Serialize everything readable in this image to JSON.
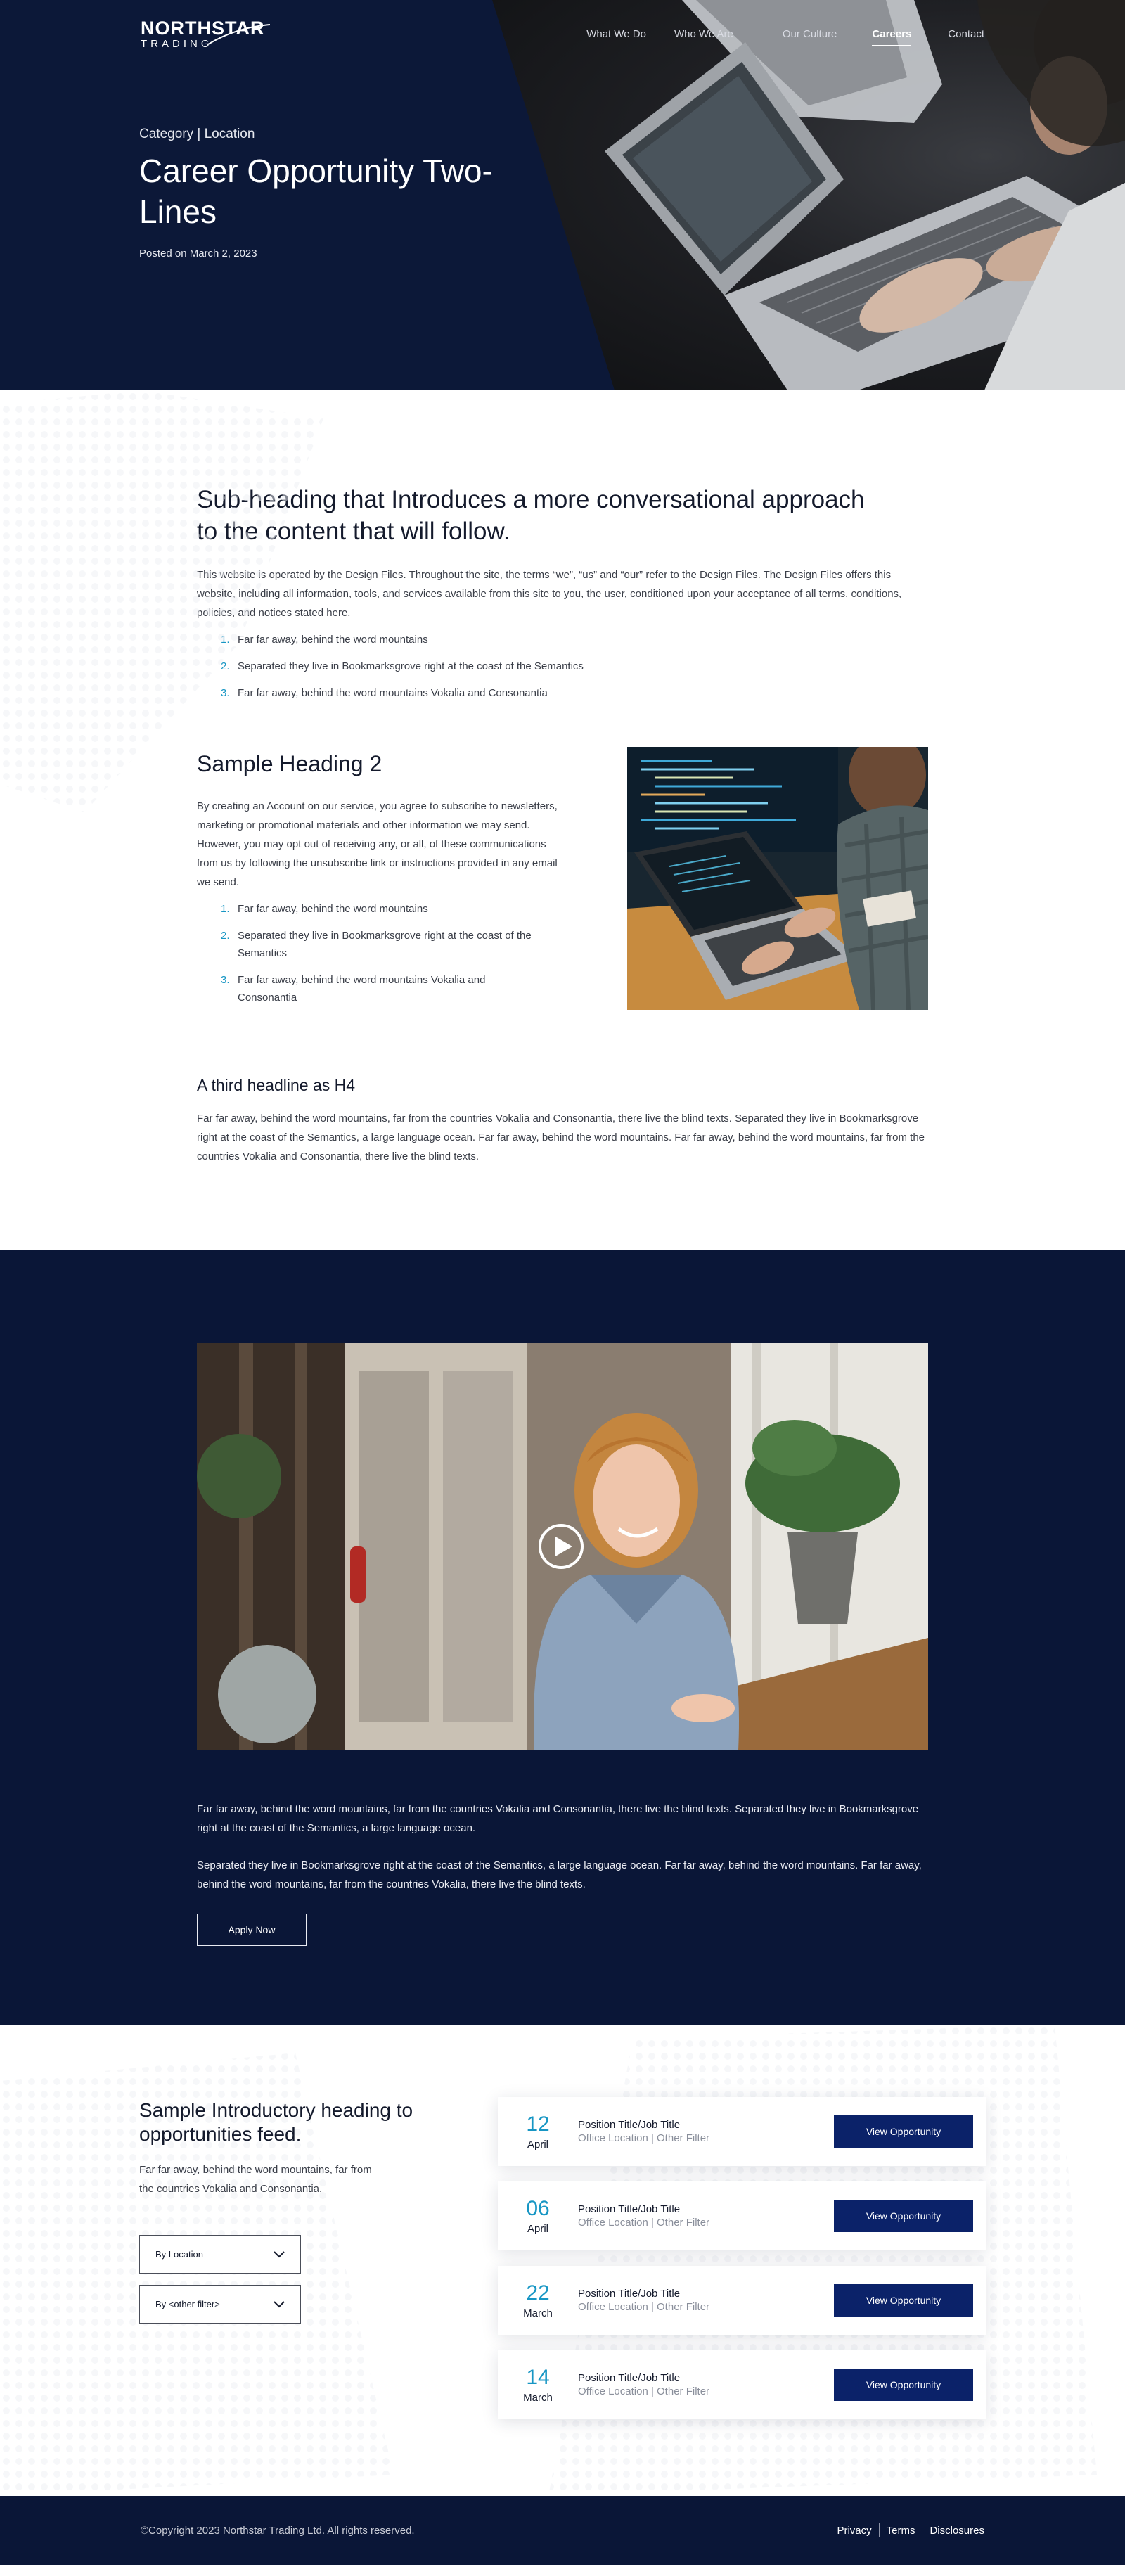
{
  "brand": {
    "logo_top": "NORTHSTAR",
    "logo_bottom": "TRADING"
  },
  "nav": {
    "items": [
      {
        "label": "What We Do"
      },
      {
        "label": "Who We Are"
      },
      {
        "label": "Our Culture"
      },
      {
        "label": "Careers",
        "active": true
      },
      {
        "label": "Contact"
      }
    ]
  },
  "hero": {
    "category": "Category | Location",
    "title": "Career Opportunity Two-Lines",
    "posted": "Posted on March 2, 2023"
  },
  "content": {
    "subheading": "Sub-heading that Introduces a more conversational approach to the content that will follow.",
    "intro": "This website is operated by the Design Files. Throughout the site, the terms “we”, “us” and “our” refer to the Design Files. The Design Files offers this website, including all information, tools, and services available from this site to you, the user, conditioned upon your acceptance of all terms, conditions, policies, and notices stated here.",
    "list1": [
      {
        "num": "1.",
        "text": "Far far away, behind the word mountains"
      },
      {
        "num": "2.",
        "text": "Separated they live in Bookmarksgrove right at the coast of the Semantics"
      },
      {
        "num": "3.",
        "text": "Far far away, behind the word mountains Vokalia and Consonantia"
      }
    ],
    "heading2": "Sample Heading 2",
    "para2": "By creating an Account on our service, you agree to subscribe to newsletters, marketing or promotional materials and other information we may send. However, you may opt out of receiving any, or all, of these communications from us by following the unsubscribe link or instructions provided in any email we send.",
    "list2": [
      {
        "num": "1.",
        "text": "Far far away, behind the word mountains"
      },
      {
        "num": "2.",
        "text": "Separated they live in Bookmarksgrove right at the coast of the Semantics"
      },
      {
        "num": "3.",
        "text": "Far far away, behind the word mountains Vokalia and Consonantia"
      }
    ],
    "heading4": "A third headline as H4",
    "para4": "Far far away, behind the word mountains, far from the countries Vokalia and Consonantia, there live the blind texts. Separated they live in Bookmarksgrove right at the coast of the Semantics, a large language ocean. Far far away, behind the word mountains. Far far away, behind the word mountains, far from the countries Vokalia and Consonantia, there live the blind texts."
  },
  "video": {
    "para1": "Far far away, behind the word mountains, far from the countries Vokalia and Consonantia, there live the blind texts. Separated they live in Bookmarksgrove right at the coast of the Semantics, a large language ocean.",
    "para2": "Separated they live in Bookmarksgrove right at the coast of the Semantics, a large language ocean. Far far away, behind the word mountains. Far far away, behind the word mountains, far from the countries Vokalia, there live the blind texts.",
    "apply_label": "Apply Now"
  },
  "jobs": {
    "heading": "Sample Introductory heading to opportunities feed.",
    "intro": "Far far away, behind the word mountains, far from the countries Vokalia and Consonantia.",
    "filter_location": "By Location",
    "filter_other": "By <other filter>",
    "items": [
      {
        "day": "12",
        "month": "April",
        "title": "Position Title/Job Title",
        "meta": "Office Location | Other Filter",
        "button": "View Opportunity"
      },
      {
        "day": "06",
        "month": "April",
        "title": "Position Title/Job Title",
        "meta": "Office Location | Other Filter",
        "button": "View Opportunity"
      },
      {
        "day": "22",
        "month": "March",
        "title": "Position Title/Job Title",
        "meta": "Office Location | Other Filter",
        "button": "View Opportunity"
      },
      {
        "day": "14",
        "month": "March",
        "title": "Position Title/Job Title",
        "meta": "Office Location | Other Filter",
        "button": "View Opportunity"
      }
    ]
  },
  "footer": {
    "copyright": "©Copyright 2023 Northstar Trading Ltd. All rights reserved.",
    "links": [
      "Privacy",
      "Terms",
      "Disclosures"
    ]
  },
  "colors": {
    "navy": "#0c1838",
    "button": "#0b2269",
    "accent_teal": "#1796c4"
  }
}
